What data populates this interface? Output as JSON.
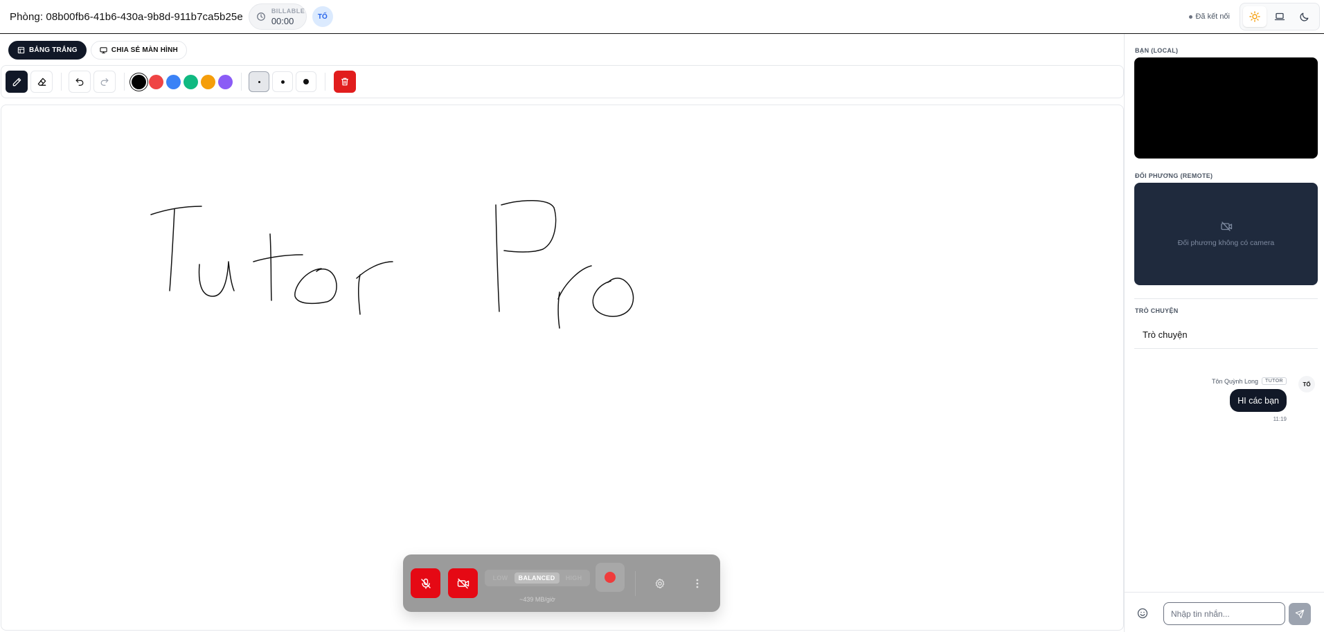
{
  "header": {
    "room_title": "Phòng: 08b00fb6-41b6-430a-9b8d-911b7ca5b25e",
    "billable_label": "BILLABLE",
    "billable_time": "00:00",
    "user_initials": "TỐ",
    "status_text": "Đã kết nối",
    "theme_options": [
      "sun-icon",
      "laptop-icon",
      "moon-icon"
    ],
    "active_theme": "light"
  },
  "tabs": [
    {
      "label": "BẢNG TRẮNG",
      "icon": "whiteboard-icon",
      "active": true
    },
    {
      "label": "CHIA SẺ MÀN HÌNH",
      "icon": "monitor-icon",
      "active": false
    }
  ],
  "toolbar": {
    "tools": [
      "pencil-icon",
      "eraser-icon"
    ],
    "history": [
      "undo-icon",
      "redo-icon"
    ],
    "colors": [
      "#000000",
      "#ef4444",
      "#3b82f6",
      "#10b981",
      "#f59e0b",
      "#8b5cf6"
    ],
    "active_color": "#000000",
    "sizes": [
      "small",
      "medium",
      "large"
    ],
    "active_size": "small",
    "clear": "trash-icon"
  },
  "controls": {
    "quality_options": [
      "LOW",
      "BALANCED",
      "HIGH"
    ],
    "active_quality": "BALANCED",
    "bitrate": "~439 MB/giờ",
    "mic_muted": true,
    "camera_off": true
  },
  "sidebar": {
    "local_label": "BẠN (LOCAL)",
    "remote_label": "ĐỐI PHƯƠNG (REMOTE)",
    "remote_no_camera": "Đối phương không có camera",
    "chat_label": "TRÒ CHUYỆN",
    "chat_title": "Trò chuyện",
    "messages": [
      {
        "author": "Tôn Quỳnh Long",
        "role": "TUTOR",
        "avatar": "TỐ",
        "text": "HI các bạn",
        "time": "11:19"
      }
    ],
    "input_placeholder": "Nhập tin nhắn..."
  },
  "colors": {
    "accent_red": "#e50914",
    "dark": "#111827",
    "remote_bg": "#1f2a3d"
  }
}
